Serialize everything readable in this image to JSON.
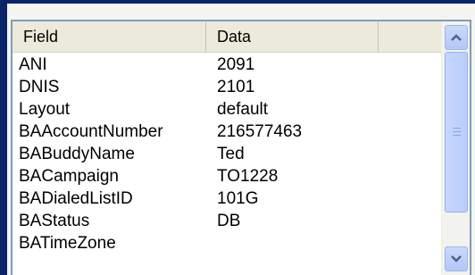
{
  "listview": {
    "columns": [
      "Field",
      "Data",
      ""
    ],
    "rows": [
      {
        "field": "ANI",
        "data": "2091"
      },
      {
        "field": "DNIS",
        "data": "2101"
      },
      {
        "field": "Layout",
        "data": "default"
      },
      {
        "field": "BAAccountNumber",
        "data": "216577463"
      },
      {
        "field": "BABuddyName",
        "data": "Ted"
      },
      {
        "field": "BACampaign",
        "data": "TO1228"
      },
      {
        "field": "BADialedListID",
        "data": "101G"
      },
      {
        "field": "BAStatus",
        "data": "DB"
      },
      {
        "field": "BATimeZone",
        "data": ""
      }
    ]
  },
  "scrollbar": {
    "up_icon": "chevron-up-icon",
    "down_icon": "chevron-down-icon",
    "scroll_position": 0
  },
  "colors": {
    "frame_accent": "#0a246a",
    "header_bg": "#ebeadb",
    "scrollbar_button": "#c1d3fb"
  }
}
